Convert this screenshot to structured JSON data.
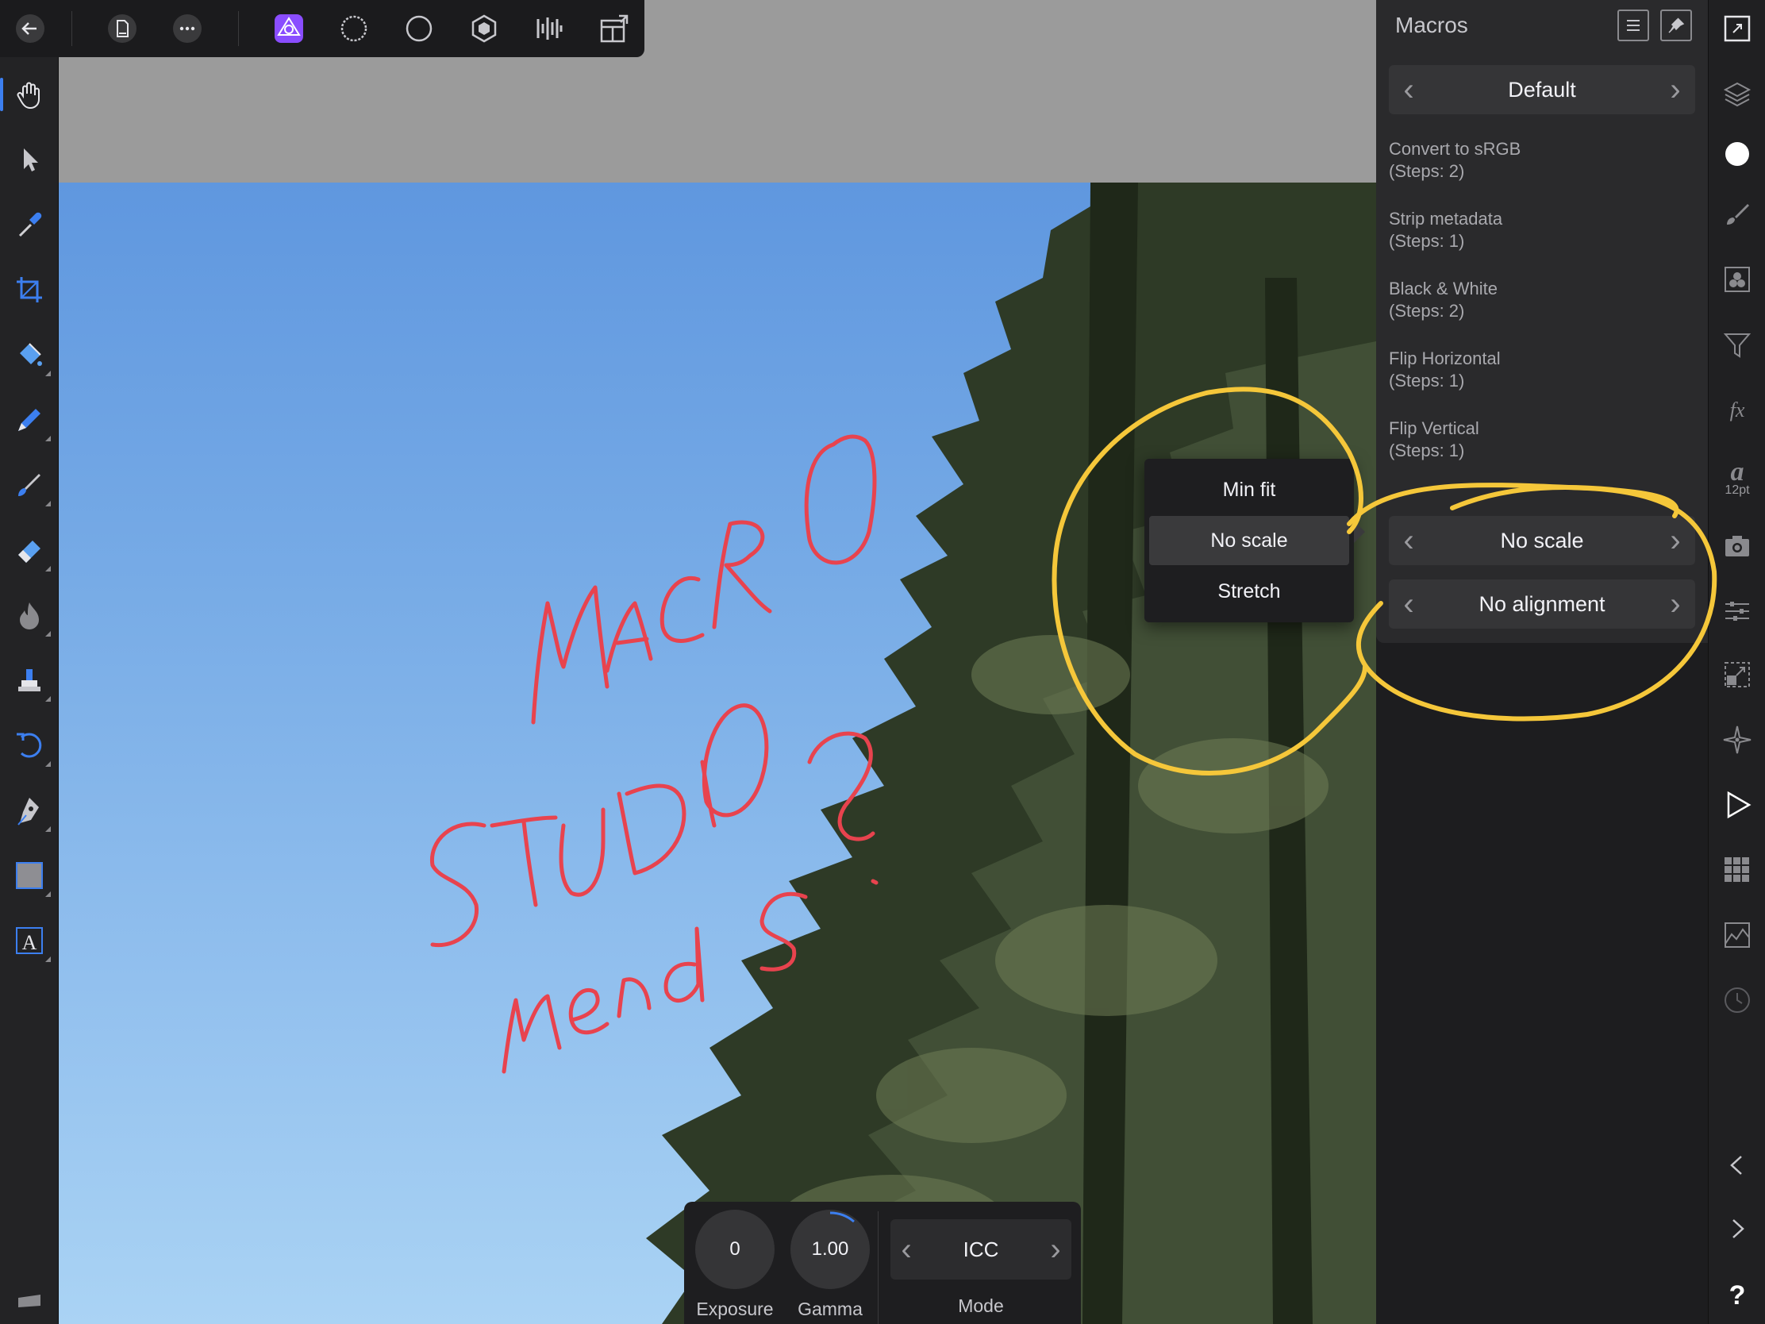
{
  "top_toolbar": {
    "buttons": [
      "back-icon",
      "document-icon",
      "more-icon",
      "photo-persona-icon",
      "liquify-persona-icon",
      "develop-persona-icon",
      "tone-mapping-persona-icon",
      "export-persona-icon",
      "view-mode-icon"
    ]
  },
  "left_toolbar": {
    "tools": [
      "view-tool-icon",
      "move-tool-icon",
      "color-picker-tool-icon",
      "crop-tool-icon",
      "flood-fill-tool-icon",
      "selection-brush-tool-icon",
      "paint-brush-tool-icon",
      "erase-brush-tool-icon",
      "burn-tool-icon",
      "clone-tool-icon",
      "undo-brush-tool-icon",
      "pen-tool-icon",
      "rectangle-tool-icon",
      "text-tool-icon"
    ],
    "active_tool": "view-tool-icon"
  },
  "macros_panel": {
    "title": "Macros",
    "category": "Default",
    "items": [
      {
        "name": "Convert to sRGB",
        "steps": "(Steps: 2)"
      },
      {
        "name": "Strip metadata",
        "steps": "(Steps: 1)"
      },
      {
        "name": "Black & White",
        "steps": "(Steps: 2)"
      },
      {
        "name": "Flip Horizontal",
        "steps": "(Steps: 1)"
      },
      {
        "name": "Flip Vertical",
        "steps": "(Steps: 1)"
      }
    ],
    "scale_mode": "No scale",
    "alignment": "No alignment"
  },
  "scale_popup": {
    "options": [
      "Min fit",
      "No scale",
      "Stretch"
    ],
    "selected": "No scale"
  },
  "right_studio_bar": {
    "icons": [
      "document-size-icon",
      "layers-icon",
      "color-icon",
      "brushes-icon",
      "channels-icon",
      "filter-icon",
      "effects-icon",
      "text-style-icon",
      "snapshots-icon",
      "adjustments-icon",
      "transform-icon",
      "navigator-icon",
      "macros-icon",
      "library-icon",
      "histogram-icon",
      "history-icon",
      "collapse-left-icon",
      "collapse-right-icon",
      "help-icon"
    ],
    "text_size_label": "12pt",
    "help_label": "?"
  },
  "context_toolbar": {
    "exposure": {
      "value": "0",
      "label": "Exposure"
    },
    "gamma": {
      "value": "1.00",
      "label": "Gamma"
    },
    "mode": {
      "value": "ICC",
      "label": "Mode"
    }
  },
  "colors": {
    "accent": "#3c7ff0",
    "persona_purple": "#8a4dff",
    "annotation_red": "#e8434e",
    "annotation_yellow": "#f5c73a"
  }
}
